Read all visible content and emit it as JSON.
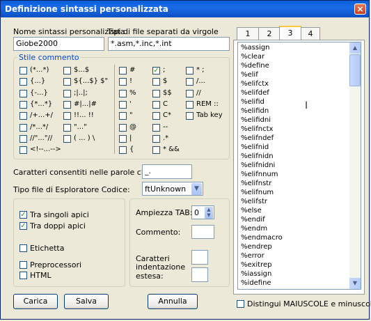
{
  "window": {
    "title": "Definizione sintassi personalizzata",
    "close": "×"
  },
  "name_field": {
    "label": "Nome sintassi personalizzata",
    "value": "Giobe2000"
  },
  "ext_field": {
    "label": "Tipi di file separati da virgole",
    "value": "*.asm,*.inc,*.int"
  },
  "comment_style": {
    "legend": "Stile commento",
    "col1": [
      "(*...*)",
      "{...}",
      "{-...}",
      "{*...*}",
      "/+...+/",
      "/*...*/",
      "//\"...\"//",
      "<!--...-->"
    ],
    "col2": [
      "$...$",
      "${...$} $\"",
      ";|..|;",
      "#|...|#",
      "!!... !!",
      "\"...\"",
      "( ... ) \\"
    ],
    "col3": [
      "#",
      "!",
      "%",
      "'",
      "\"",
      "@",
      "|",
      "{"
    ],
    "col4": [
      "; ",
      "$",
      "$$",
      "C",
      "C*",
      "--",
      ".*",
      "* &&"
    ],
    "col4_checked": [
      true,
      false,
      false,
      false,
      false,
      false,
      false,
      false
    ],
    "col5": [
      "* ;",
      "/...",
      "//",
      "REM ::",
      "Tab key"
    ]
  },
  "allowed_chars": {
    "label": "Caratteri consentiti nelle parole chiave:",
    "value": "_."
  },
  "explorer_type": {
    "label": "Tipo file di Esploratore Codice:",
    "value": "ftUnknown"
  },
  "options": {
    "single_quotes": {
      "label": "Tra singoli apici",
      "checked": true
    },
    "double_quotes": {
      "label": "Tra doppi apici",
      "checked": true
    },
    "label": {
      "label": "Etichetta",
      "checked": false
    },
    "preprocessors": {
      "label": "Preprocessori",
      "checked": false
    },
    "html": {
      "label": "HTML",
      "checked": false
    }
  },
  "tab_settings": {
    "tab_width_label": "Ampiezza TAB:",
    "tab_width_value": "0",
    "comment_label": "Commento:",
    "indent_label_1": "Caratteri",
    "indent_label_2": "indentazione",
    "indent_label_3": "estesa:"
  },
  "tabs": [
    "1",
    "2",
    "3",
    "4"
  ],
  "active_tab": "3",
  "keywords": [
    "%assign",
    "%clear",
    "%define",
    "%elif",
    "%elifctx",
    "%elifdef",
    "%elifid",
    "%elifidn",
    "%elifidni",
    "%elifnctx",
    "%elifndef",
    "%elifnid",
    "%elifnidn",
    "%elifnidni",
    "%elifnnum",
    "%elifnstr",
    "%elifnum",
    "%elifstr",
    "%else",
    "%endif",
    "%endm",
    "%endmacro",
    "%endrep",
    "%error",
    "%exitrep",
    "%iassign",
    "%idefine"
  ],
  "case_sensitive": {
    "label": "Distingui MAIUSCOLE e minuscole",
    "checked": false
  },
  "buttons": {
    "load": "Carica",
    "save": "Salva",
    "cancel": "Annulla"
  },
  "colors": {
    "title_bar": "#0a5fd8",
    "group_legend": "#0046d5",
    "checkmark": "#21a121"
  }
}
